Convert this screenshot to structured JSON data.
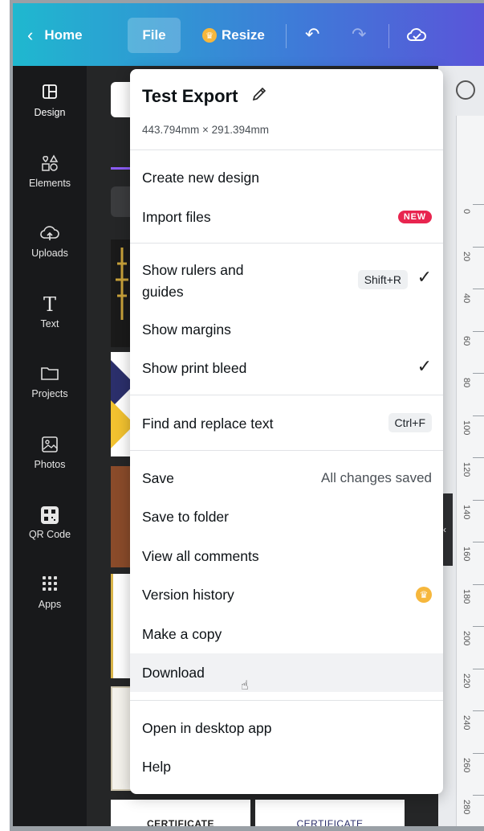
{
  "topbar": {
    "home_label": "Home",
    "file_label": "File",
    "resize_label": "Resize",
    "icons": [
      "chevron-left-icon",
      "crown-icon",
      "undo-icon",
      "redo-icon",
      "cloud-check-icon"
    ]
  },
  "sidebar": {
    "items": [
      {
        "label": "Design",
        "icon": "layout-icon"
      },
      {
        "label": "Elements",
        "icon": "shapes-icon"
      },
      {
        "label": "Uploads",
        "icon": "cloud-upload-icon"
      },
      {
        "label": "Text",
        "icon": "text-icon"
      },
      {
        "label": "Projects",
        "icon": "folder-icon"
      },
      {
        "label": "Photos",
        "icon": "image-icon"
      },
      {
        "label": "QR Code",
        "icon": "qr-code-icon"
      },
      {
        "label": "Apps",
        "icon": "grid-icon"
      }
    ]
  },
  "menu": {
    "title": "Test Export",
    "dimensions": "443.794mm × 291.394mm",
    "create_new": "Create new design",
    "import_files": "Import files",
    "new_badge": "NEW",
    "show_rulers": "Show rulers and guides",
    "show_rulers_shortcut": "Shift+R",
    "show_margins": "Show margins",
    "show_print_bleed": "Show print bleed",
    "find_replace": "Find and replace text",
    "find_replace_shortcut": "Ctrl+F",
    "save": "Save",
    "save_status": "All changes saved",
    "save_to_folder": "Save to folder",
    "view_comments": "View all comments",
    "version_history": "Version history",
    "make_copy": "Make a copy",
    "download": "Download",
    "open_desktop": "Open in desktop app",
    "help": "Help"
  },
  "ruler": {
    "labels": [
      "0",
      "20",
      "40",
      "60",
      "80",
      "100",
      "120",
      "140",
      "160",
      "180",
      "200",
      "220",
      "240",
      "260",
      "280"
    ]
  },
  "templates": {
    "cert1": "CERTIFICATE",
    "cert2": "CERTIFICATE"
  },
  "colors": {
    "topbar_start": "#1fb8cf",
    "topbar_end": "#5a55d9",
    "new_badge": "#e8254f",
    "crown": "#f6b73c"
  }
}
